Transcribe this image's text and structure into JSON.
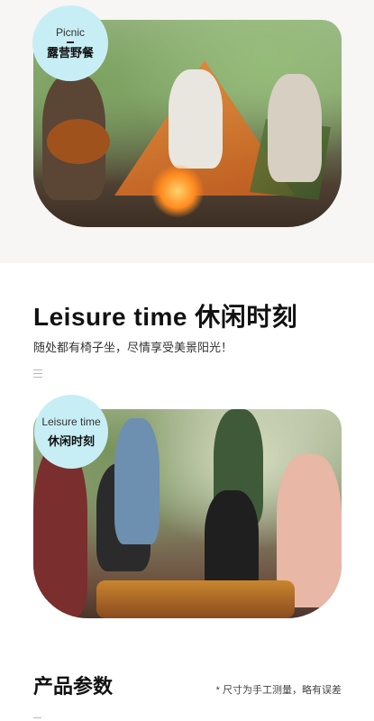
{
  "section1": {
    "badge_en": "Picnic",
    "badge_cn": "露营野餐",
    "image_alt": "people camping by a tent and campfire"
  },
  "section2": {
    "title": "Leisure time 休闲时刻",
    "subtitle": "随处都有椅子坐，尽情享受美景阳光！",
    "badge_en": "Leisure time",
    "badge_cn": "休闲时刻",
    "image_alt": "friends having a picnic with wine outdoors"
  },
  "params": {
    "title": "产品参数",
    "note": "* 尺寸为手工测量，略有误差"
  },
  "colors": {
    "badge_bg": "#c8eef5",
    "top_section_bg": "#f7f6f4"
  }
}
